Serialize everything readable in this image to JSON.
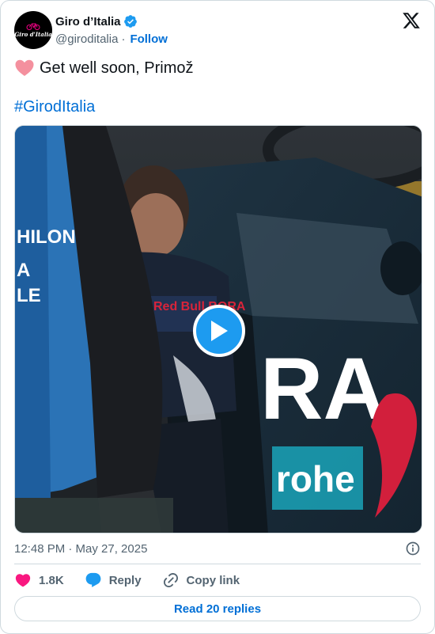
{
  "account": {
    "avatar_text": "Giro d'Italia",
    "name": "Giro d’Italia",
    "handle": "@giroditalia",
    "separator": "·",
    "follow_label": "Follow"
  },
  "post": {
    "text": "Get well soon, Primož",
    "hashtag": "#GirodItalia",
    "timestamp": "12:48 PM · May 27, 2025"
  },
  "media": {
    "type": "video",
    "play_icon": "play-icon",
    "jersey_text": "HILON\nA\nLE",
    "car_text_1": "RA",
    "car_text_2": "rohe",
    "helmet_text": "Red Bull BORA"
  },
  "actions": {
    "like_count": "1.8K",
    "reply_label": "Reply",
    "copy_label": "Copy link",
    "read_replies_label": "Read 20 replies"
  },
  "colors": {
    "link": "#006fd6",
    "verified": "#1d9bf0",
    "like": "#f91880",
    "muted": "#536471",
    "border": "#cfd9de"
  }
}
